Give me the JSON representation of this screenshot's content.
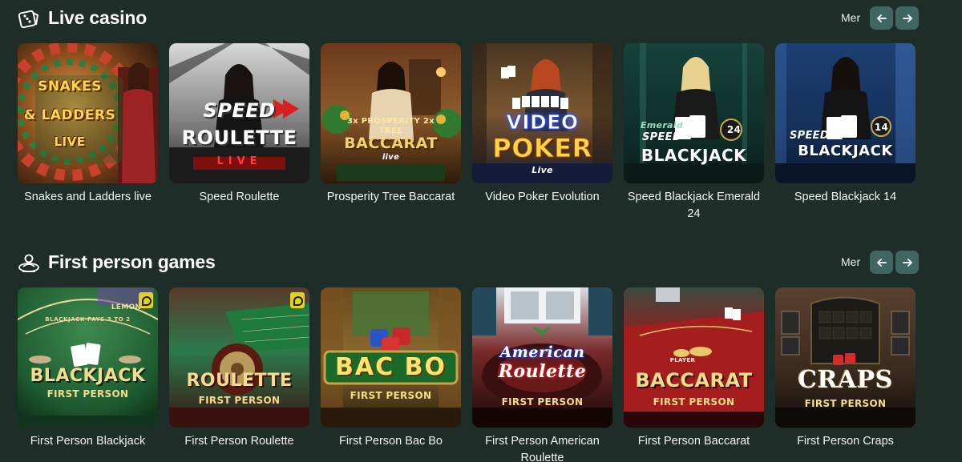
{
  "sections": [
    {
      "title": "Live casino",
      "icon": "dice-icon",
      "more_label": "Mer",
      "games": [
        {
          "title": "Snakes and Ladders live",
          "logo_lines": [
            "SNAKES",
            "& LADDERS",
            "LIVE"
          ]
        },
        {
          "title": "Speed Roulette",
          "logo_lines": [
            "SPEED",
            "ROULETTE",
            "LIVE"
          ]
        },
        {
          "title": "Prosperity Tree Baccarat",
          "logo_lines": [
            "3x PROSPERITY 2x",
            "TREE",
            "BACCARAT",
            "live"
          ]
        },
        {
          "title": "Video Poker Evolution",
          "logo_lines": [
            "VIDEO",
            "POKER",
            "Live"
          ]
        },
        {
          "title": "Speed Blackjack Emerald 24",
          "logo_lines": [
            "Emerald",
            "SPEED",
            "BLACKJACK",
            "24"
          ]
        },
        {
          "title": "Speed Blackjack 14",
          "logo_lines": [
            "SPEED",
            "BLACKJACK",
            "14"
          ]
        }
      ]
    },
    {
      "title": "First person games",
      "icon": "first-person-icon",
      "more_label": "Mer",
      "games": [
        {
          "title": "First Person Blackjack",
          "logo_lines": [
            "BLACKJACK",
            "FIRST PERSON"
          ],
          "table_text": "BLACKJACK PAYS 3 TO 2",
          "brand": "LEMON"
        },
        {
          "title": "First Person Roulette",
          "logo_lines": [
            "ROULETTE",
            "FIRST PERSON"
          ]
        },
        {
          "title": "First Person Bac Bo",
          "logo_lines": [
            "BAC BO",
            "FIRST PERSON"
          ]
        },
        {
          "title": "First Person American Roulette",
          "logo_lines": [
            "American",
            "Roulette",
            "FIRST PERSON"
          ]
        },
        {
          "title": "First Person Baccarat",
          "logo_lines": [
            "BACCARAT",
            "FIRST PERSON"
          ],
          "table_text": "PLAYER"
        },
        {
          "title": "First Person Craps",
          "logo_lines": [
            "CRAPS",
            "FIRST PERSON"
          ]
        }
      ]
    }
  ],
  "colors": {
    "background": "#1f2d29",
    "nav_button": "#3f6660",
    "text": "#ffffff"
  }
}
